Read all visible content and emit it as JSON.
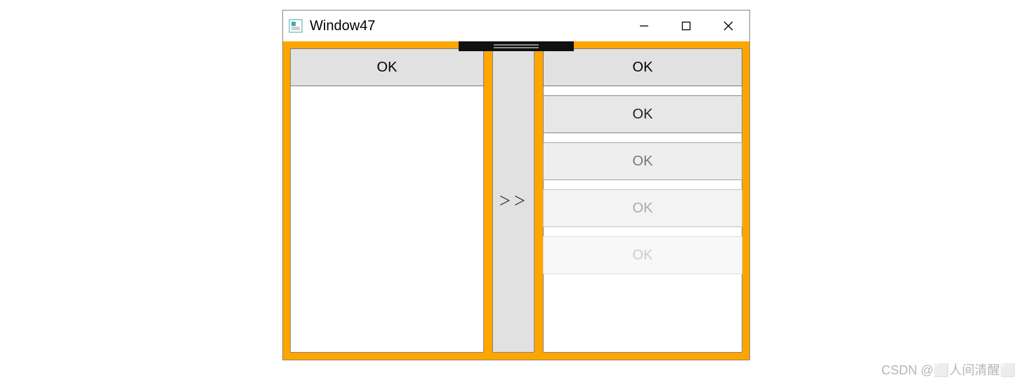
{
  "window": {
    "title": "Window47"
  },
  "left_panel": {
    "buttons": [
      {
        "label": "OK"
      }
    ]
  },
  "center_button": {
    "label": "＞＞"
  },
  "right_panel": {
    "buttons": [
      {
        "label": "OK"
      },
      {
        "label": "OK"
      },
      {
        "label": "OK"
      },
      {
        "label": "OK"
      },
      {
        "label": "OK"
      }
    ]
  },
  "watermark": "CSDN @⬜人间清醒⬜"
}
